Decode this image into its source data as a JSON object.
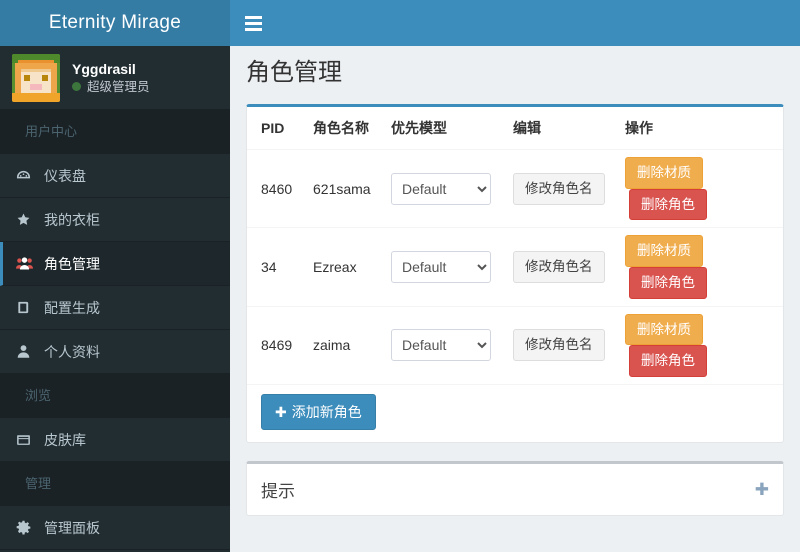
{
  "brand": {
    "title": "Eternity Mirage"
  },
  "header": {
    "menu_toggle_label": "☰"
  },
  "user": {
    "name": "Yggdrasil",
    "role": "超级管理员",
    "status_color": "#3c763d",
    "avatar_name": "user-avatar"
  },
  "sidebar": {
    "sections": [
      {
        "header": "用户中心",
        "items": [
          {
            "label": "仪表盘",
            "icon": "dashboard-icon",
            "name": "sidebar-item-dashboard",
            "active": false
          },
          {
            "label": "我的衣柜",
            "icon": "star-icon",
            "name": "sidebar-item-wardrobe",
            "active": false
          },
          {
            "label": "角色管理",
            "icon": "users-icon",
            "name": "sidebar-item-character-manage",
            "active": true
          },
          {
            "label": "配置生成",
            "icon": "book-icon",
            "name": "sidebar-item-config-generate",
            "active": false
          },
          {
            "label": "个人资料",
            "icon": "user-icon",
            "name": "sidebar-item-profile",
            "active": false
          }
        ]
      },
      {
        "header": "浏览",
        "items": [
          {
            "label": "皮肤库",
            "icon": "image-icon",
            "name": "sidebar-item-skin-library",
            "active": false
          }
        ]
      },
      {
        "header": "管理",
        "items": [
          {
            "label": "管理面板",
            "icon": "gear-icon",
            "name": "sidebar-item-admin-panel",
            "active": false
          }
        ]
      }
    ]
  },
  "main": {
    "page_title": "角色管理",
    "table": {
      "columns": [
        "PID",
        "角色名称",
        "优先模型",
        "编辑",
        "操作"
      ],
      "rows": [
        {
          "pid": "8460",
          "name": "621sama",
          "model": "Default",
          "edit_label": "修改角色名",
          "delete_texture_label": "删除材质",
          "delete_role_label": "删除角色"
        },
        {
          "pid": "34",
          "name": "Ezreax",
          "model": "Default",
          "edit_label": "修改角色名",
          "delete_texture_label": "删除材质",
          "delete_role_label": "删除角色"
        },
        {
          "pid": "8469",
          "name": "zaima",
          "model": "Default",
          "edit_label": "修改角色名",
          "delete_texture_label": "删除材质",
          "delete_role_label": "删除角色"
        }
      ],
      "model_options": [
        "Default"
      ]
    },
    "add_button": {
      "label": "添加新角色",
      "icon": "plus-icon"
    },
    "tips_panel": {
      "title": "提示",
      "toggle_icon": "plus-icon"
    }
  },
  "colors": {
    "brand_blue": "#3c8dbc",
    "brand_blue_dark": "#357ca5",
    "sidebar_bg": "#222d32",
    "page_bg": "#ecf0f3",
    "warning": "#f0ad4e",
    "danger": "#d9534f",
    "online_green": "#3c763d"
  }
}
